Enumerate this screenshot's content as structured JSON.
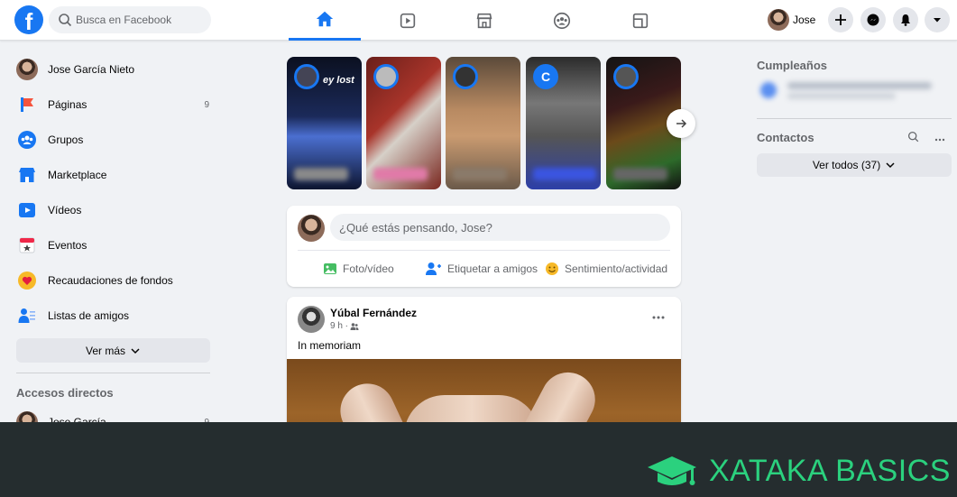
{
  "topbar": {
    "search_placeholder": "Busca en Facebook",
    "nav_tabs": [
      {
        "name": "home",
        "active": true
      },
      {
        "name": "watch",
        "active": false
      },
      {
        "name": "marketplace",
        "active": false
      },
      {
        "name": "groups",
        "active": false
      },
      {
        "name": "gaming",
        "active": false
      }
    ],
    "profile_name": "Jose",
    "actions": [
      "plus-icon",
      "messenger-icon",
      "bell-icon",
      "caret-down-icon"
    ],
    "accent_color": "#1877f2"
  },
  "sidebar": {
    "items": [
      {
        "label": "Jose García Nieto",
        "icon": "avatar",
        "count": ""
      },
      {
        "label": "Páginas",
        "icon": "flag-icon",
        "count": "9"
      },
      {
        "label": "Grupos",
        "icon": "groups-icon",
        "count": ""
      },
      {
        "label": "Marketplace",
        "icon": "shop-icon",
        "count": ""
      },
      {
        "label": "Vídeos",
        "icon": "video-icon",
        "count": ""
      },
      {
        "label": "Eventos",
        "icon": "calendar-icon",
        "count": ""
      },
      {
        "label": "Recaudaciones de fondos",
        "icon": "heart-icon",
        "count": ""
      },
      {
        "label": "Listas de amigos",
        "icon": "friends-list-icon",
        "count": ""
      }
    ],
    "see_more_label": "Ver más",
    "shortcuts_title": "Accesos directos",
    "shortcut_item": {
      "label": "Jose García",
      "count": "9"
    }
  },
  "stories": [
    {
      "caption": "ey lost"
    },
    {
      "caption": ""
    },
    {
      "caption": ""
    },
    {
      "caption": "C"
    },
    {
      "caption": ""
    }
  ],
  "composer": {
    "placeholder": "¿Qué estás pensando, Jose?",
    "actions": [
      {
        "label": "Foto/vídeo",
        "icon": "photo-icon"
      },
      {
        "label": "Etiquetar a amigos",
        "icon": "tag-friends-icon"
      },
      {
        "label": "Sentimiento/actividad",
        "icon": "smiley-icon"
      }
    ]
  },
  "post": {
    "author": "Yúbal Fernández",
    "time": "9 h ·",
    "audience_icon": "friends-icon",
    "text": "In memoriam"
  },
  "right": {
    "birthdays_title": "Cumpleaños",
    "contacts_title": "Contactos",
    "see_all_label": "Ver todos (37)"
  },
  "banner": {
    "brand_text": "XATAKA BASICS",
    "brand_color": "#2bd17e"
  }
}
